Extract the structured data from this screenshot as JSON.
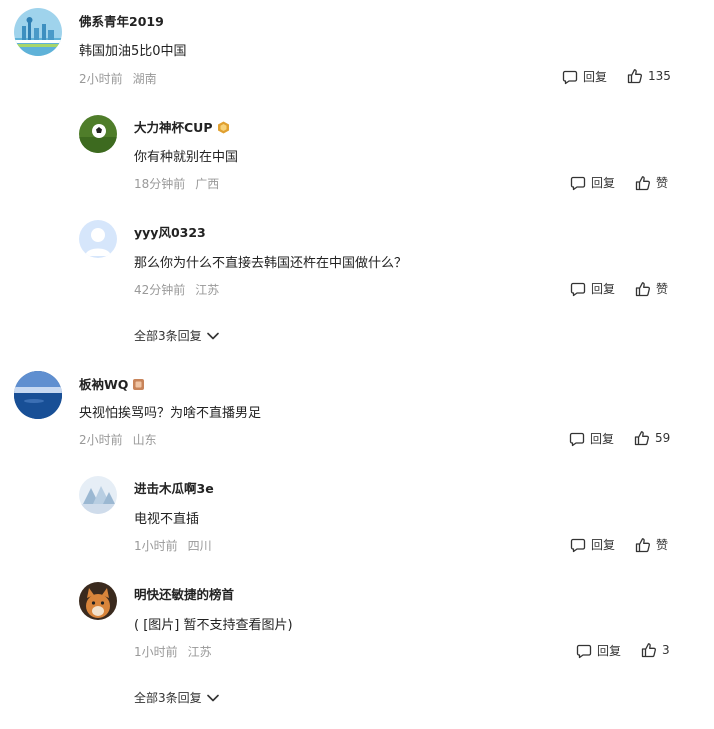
{
  "comments": [
    {
      "name": "佛系青年2019",
      "text": "韩国加油5比0中国",
      "time": "2小时前",
      "location": "湖南",
      "reply_label": "回复",
      "like_label": "135",
      "badge": "",
      "replies": [
        {
          "name": "大力神杯CUP",
          "text": "你有种就别在中国",
          "time": "18分钟前",
          "location": "广西",
          "reply_label": "回复",
          "like_label": "赞",
          "badge": "gold-level-badge"
        },
        {
          "name": "yyy风0323",
          "text": "那么你为什么不直接去韩国还杵在中国做什么？",
          "time": "42分钟前",
          "location": "江苏",
          "reply_label": "回复",
          "like_label": "赞",
          "badge": ""
        }
      ],
      "more_label": "全部3条回复"
    },
    {
      "name": "板衲WQ",
      "text": "央视怕挨骂吗？为啥不直播男足",
      "time": "2小时前",
      "location": "山东",
      "reply_label": "回复",
      "like_label": "59",
      "badge": "bronze-level-badge",
      "replies": [
        {
          "name": "进击木瓜啊3e",
          "text": "电视不直插",
          "time": "1小时前",
          "location": "四川",
          "reply_label": "回复",
          "like_label": "赞",
          "badge": ""
        },
        {
          "name": "明快还敏捷的榜首",
          "text": "( [图片] 暂不支持查看图片)",
          "time": "1小时前",
          "location": "江苏",
          "reply_label": "回复",
          "like_label": "3",
          "badge": ""
        }
      ],
      "more_label": "全部3条回复"
    }
  ],
  "icons": {
    "reply": "reply-bubble-icon",
    "like": "thumbs-up-icon",
    "expand": "chevron-down-icon"
  },
  "colors": {
    "name": "#222222",
    "meta": "#999999",
    "badge_gold": "#e0a030",
    "badge_bronze": "#c8845a"
  }
}
